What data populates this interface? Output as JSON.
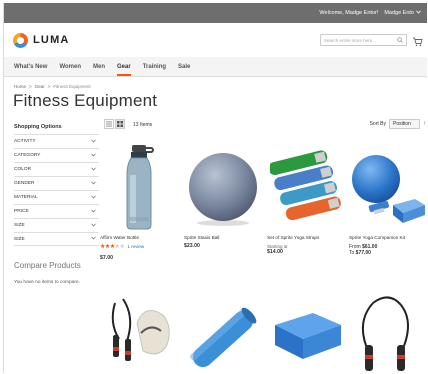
{
  "top_panel": {
    "welcome": "Welcome, Madge Entor!",
    "account_name": "Madge Ento"
  },
  "header": {
    "logo_text": "LUMA",
    "search_placeholder": "Search entire store here..."
  },
  "nav": [
    "What's New",
    "Women",
    "Men",
    "Gear",
    "Training",
    "Sale"
  ],
  "nav_active_index": 3,
  "breadcrumbs": {
    "home": "Home",
    "sep": ">",
    "gear": "Gear",
    "current": "Fitness Equipment"
  },
  "page_title": "Fitness Equipment",
  "sidebar": {
    "heading": "Shopping Options",
    "filters": [
      "ACTIVITY",
      "CATEGORY",
      "COLOR",
      "GENDER",
      "MATERIAL",
      "PRICE",
      "SIZE",
      "SIZE"
    ],
    "compare_title": "Compare Products",
    "compare_empty": "You have no items to compare."
  },
  "toolbar": {
    "amount": "13 Items",
    "sort_label": "Sort By",
    "sort_value": "Position",
    "sort_dir_icon": "arrow-up-icon"
  },
  "products": [
    {
      "name": "Affirm Water Bottle",
      "rating_pct": 60,
      "reviews": "1 review",
      "price": "$7.00"
    },
    {
      "name": "Sprite Stasis Ball",
      "price": "$23.00"
    },
    {
      "name": "Set of Sprite Yoga Straps",
      "price_label": "Starting at",
      "price": "$14.00"
    },
    {
      "name": "Sprite Yoga Companion Kit",
      "from_label": "From",
      "from_price": "$61.00",
      "to_label": "To",
      "to_price": "$77.00"
    }
  ],
  "colors": {
    "accent": "#ff5501",
    "link": "#1979c3",
    "top_panel": "#6e6e6e",
    "nav_bg": "#f4f4f4"
  }
}
